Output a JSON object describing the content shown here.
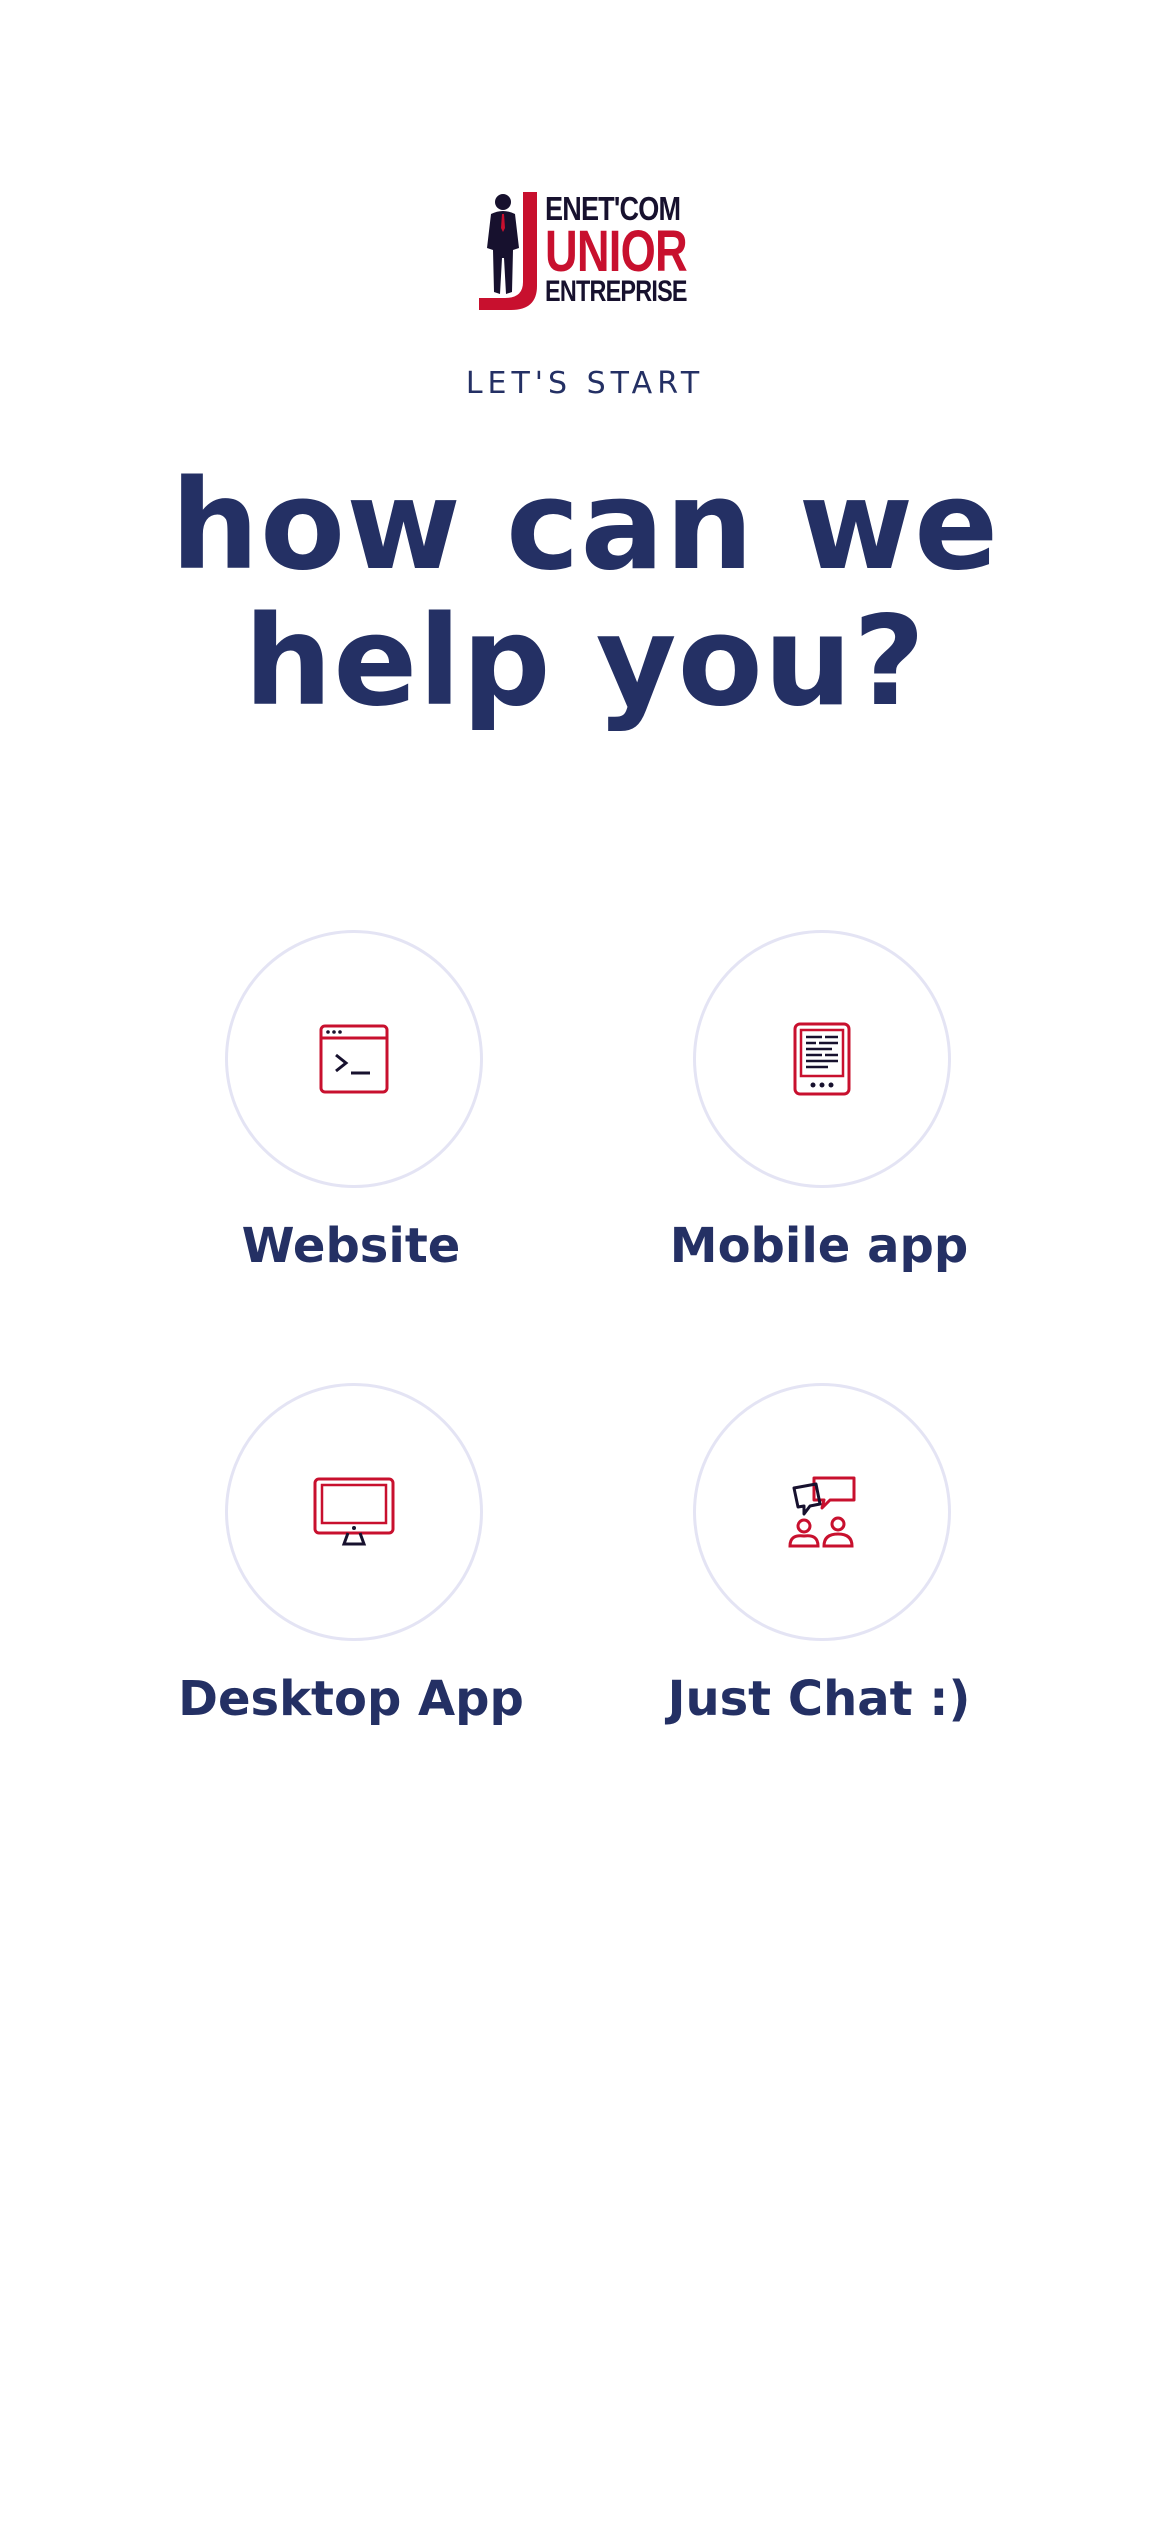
{
  "brand": {
    "logo_line1": "ENET'COM",
    "logo_line2": "UNIOR",
    "logo_line3": "ENTREPRISE",
    "logo_icon": "businessman-j-icon",
    "colors": {
      "navy": "#243064",
      "red": "#c8102e",
      "dark": "#17112e",
      "circle_border": "#e4e4f4"
    }
  },
  "header": {
    "eyebrow": "LET'S START",
    "headline_line1": "how can we",
    "headline_line2": "help you?"
  },
  "options": [
    {
      "label": "Website",
      "icon": "browser-terminal-icon"
    },
    {
      "label": "Mobile app",
      "icon": "mobile-phone-icon"
    },
    {
      "label": "Desktop App",
      "icon": "desktop-monitor-icon"
    },
    {
      "label": "Just Chat :)",
      "icon": "chat-people-icon"
    }
  ]
}
